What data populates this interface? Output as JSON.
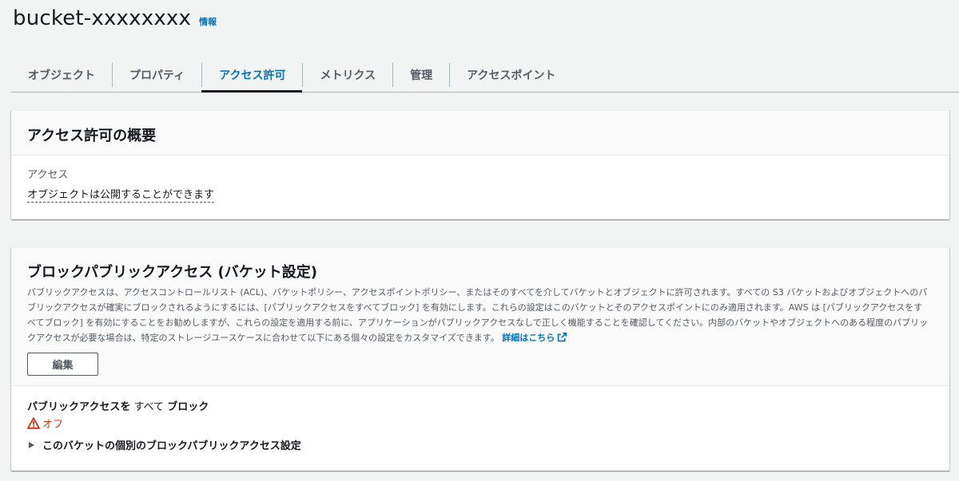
{
  "header": {
    "bucket_name": "bucket-xxxxxxxx",
    "info_link": "情報"
  },
  "tabs": [
    {
      "label": "オブジェクト",
      "active": false
    },
    {
      "label": "プロパティ",
      "active": false
    },
    {
      "label": "アクセス許可",
      "active": true
    },
    {
      "label": "メトリクス",
      "active": false
    },
    {
      "label": "管理",
      "active": false
    },
    {
      "label": "アクセスポイント",
      "active": false
    }
  ],
  "permissions_overview": {
    "title": "アクセス許可の概要",
    "access_label": "アクセス",
    "access_value": "オブジェクトは公開することができます"
  },
  "block_public_access": {
    "title": "ブロックパブリックアクセス (バケット設定)",
    "description": "パブリックアクセスは、アクセスコントロールリスト (ACL)、バケットポリシー、アクセスポイントポリシー、またはそのすべてを介してバケットとオブジェクトに許可されます。すべての S3 バケットおよびオブジェクトへのパブリックアクセスが確実にブロックされるようにするには、[パブリックアクセスをすべてブロック] を有効にします。これらの設定はこのバケットとそのアクセスポイントにのみ適用されます。AWS は [パブリックアクセスをすべてブロック] を有効にすることをお勧めしますが、これらの設定を適用する前に、アプリケーションがパブリックアクセスなしで正しく機能することを確認してください。内部のバケットやオブジェクトへのある程度のパブリックアクセスが必要な場合は、特定のストレージユースケースに合わせて以下にある個々の設定をカスタマイズできます。",
    "learn_more": "詳細はこちら",
    "edit_button": "編集",
    "block_all_part1": "パブリックアクセスを",
    "block_all_part2": "すべて",
    "block_all_part3": "ブロック",
    "status": "オフ",
    "expander_label": "このバケットの個別のブロックパブリックアクセス設定"
  },
  "colors": {
    "link": "#0073bb",
    "warning": "#d13212",
    "text": "#16191f",
    "muted": "#545b64",
    "background": "#f2f3f3"
  },
  "icons": {
    "warning": "warning-icon",
    "external_link": "external-link-icon",
    "caret": "caret-right-icon"
  }
}
